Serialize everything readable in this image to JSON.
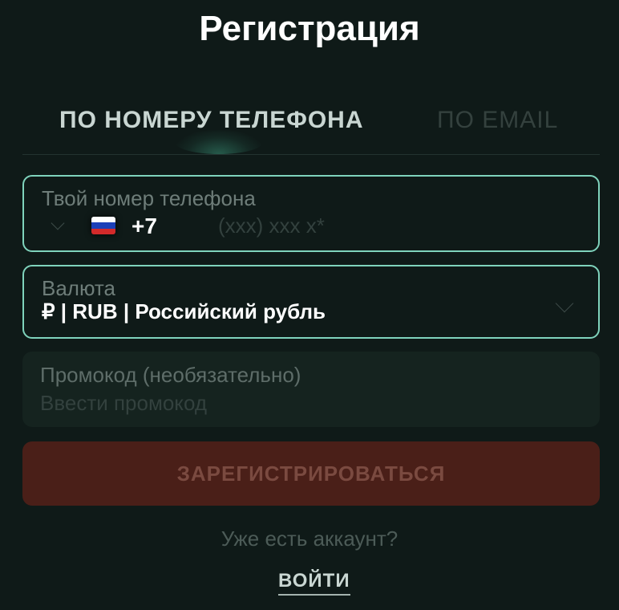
{
  "page": {
    "title": "Регистрация"
  },
  "tabs": [
    {
      "label": "ПО НОМЕРУ ТЕЛЕФОНА",
      "active": true
    },
    {
      "label": "ПО EMAIL",
      "active": false
    }
  ],
  "phone": {
    "label": "Твой номер телефона",
    "country_icon": "russia-flag-icon",
    "country_code": "+7",
    "placeholder": "(xxx) xxx x*",
    "value": ""
  },
  "currency": {
    "label": "Валюта",
    "selected": "₽ | RUB | Российский рубль",
    "icon": "chevron-down-icon"
  },
  "promo": {
    "label": "Промокод (необязательно)",
    "placeholder": "Ввести промокод",
    "value": ""
  },
  "register_button": {
    "label": "ЗАРЕГИСТРИРОВАТЬСЯ",
    "enabled": false
  },
  "footer": {
    "have_account_text": "Уже есть аккаунт?",
    "login_label": "ВОЙТИ"
  },
  "colors": {
    "background": "#0f1a18",
    "accent_border": "#7fd3bc",
    "button_disabled": "#4a1f18"
  }
}
